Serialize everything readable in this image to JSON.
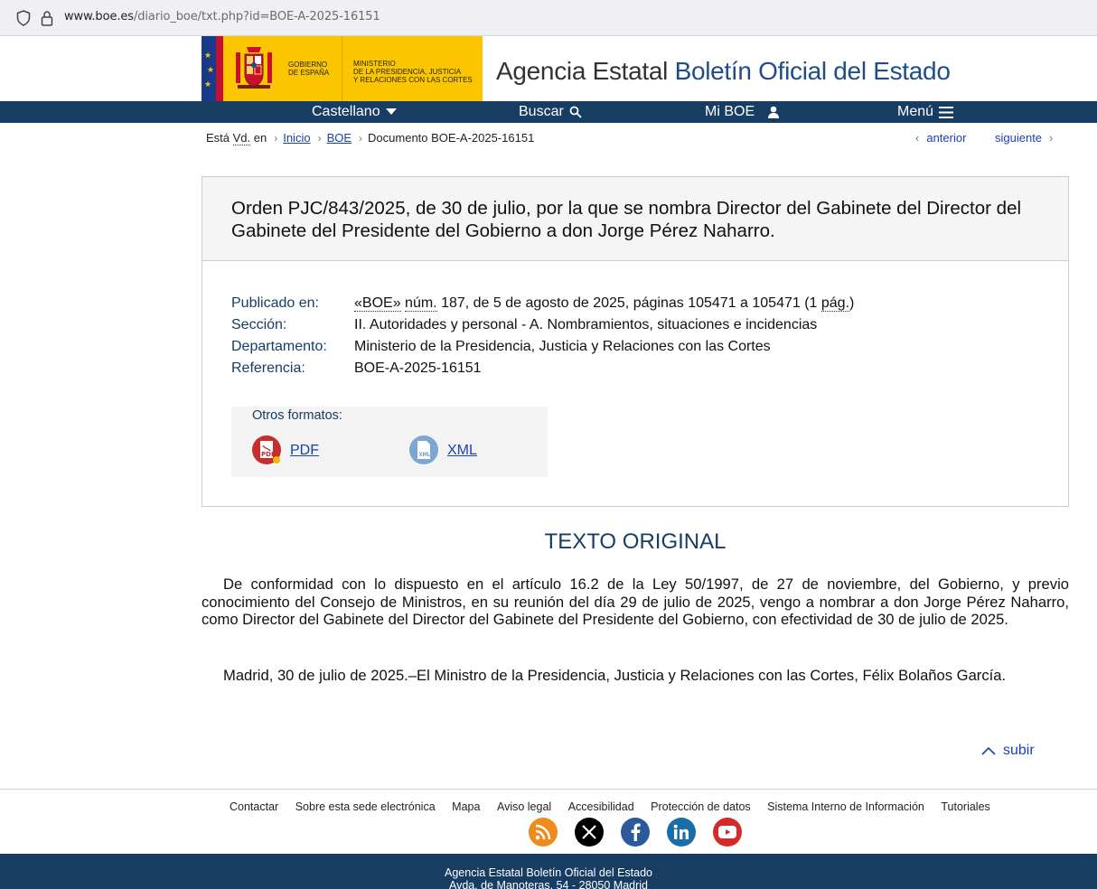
{
  "browser": {
    "url_domain": "www.boe.es",
    "url_path": "/diario_boe/txt.php?id=BOE-A-2025-16151"
  },
  "header": {
    "gobierno": [
      "GOBIERNO",
      "DE ESPAÑA"
    ],
    "ministerio": [
      "MINISTERIO",
      "DE LA PRESIDENCIA, JUSTICIA",
      "Y RELACIONES CON LAS CORTES"
    ],
    "agency_prefix": "Agencia Estatal",
    "agency_name": "Boletín Oficial del Estado"
  },
  "nav": {
    "language": "Castellano",
    "search": "Buscar",
    "my_boe": "Mi BOE",
    "menu": "Menú"
  },
  "breadcrumb": {
    "label_pre": "Está ",
    "label_vd": "Vd.",
    "label_post": " en",
    "items": [
      "Inicio",
      "BOE",
      "Documento BOE-A-2025-16151"
    ],
    "prev": "anterior",
    "next": "siguiente"
  },
  "document": {
    "title": "Orden PJC/843/2025, de 30 de julio, por la que se nombra Director del Gabinete del Director del Gabinete del Presidente del Gobierno a don Jorge Pérez Naharro.",
    "meta": {
      "published_label": "Publicado en:",
      "published_boe": "«BOE»",
      "published_num": "núm.",
      "published_rest": " 187, de 5 de agosto de 2025, páginas 105471 a 105471 (1 ",
      "published_pag": "pág.",
      "published_close": ")",
      "section_label": "Sección:",
      "section_value": "II. Autoridades y personal - A. Nombramientos, situaciones e incidencias",
      "department_label": "Departamento:",
      "department_value": "Ministerio de la Presidencia, Justicia y Relaciones con las Cortes",
      "reference_label": "Referencia:",
      "reference_value": "BOE-A-2025-16151"
    },
    "formats": {
      "label": "Otros formatos:",
      "pdf": "PDF",
      "xml": "XML"
    }
  },
  "body": {
    "section_title": "TEXTO ORIGINAL",
    "paragraph1": "De conformidad con lo dispuesto en el artículo 16.2 de la Ley 50/1997, de 27 de noviembre, del Gobierno, y previo conocimiento del Consejo de Ministros, en su reunión del día 29 de julio de 2025, vengo a nombrar a don Jorge Pérez Naharro, como Director del Gabinete del Director del Gabinete del Presidente del Gobierno, con efectividad de 30 de julio de 2025.",
    "paragraph2": "Madrid, 30 de julio de 2025.–El Ministro de la Presidencia, Justicia y Relaciones con las Cortes, Félix Bolaños García.",
    "back_to_top": "subir"
  },
  "footer": {
    "links": [
      "Contactar",
      "Sobre esta sede electrónica",
      "Mapa",
      "Aviso legal",
      "Accesibilidad",
      "Protección de datos",
      "Sistema Interno de Información",
      "Tutoriales"
    ],
    "socials": [
      {
        "icon": "rss-icon",
        "color": "#f08a1c"
      },
      {
        "icon": "x-icon",
        "color": "#000000"
      },
      {
        "icon": "facebook-icon",
        "color": "#2a5a9a"
      },
      {
        "icon": "linkedin-icon",
        "color": "#1a6ea8"
      },
      {
        "icon": "youtube-icon",
        "color": "#d62a2a"
      }
    ],
    "org": "Agencia Estatal Boletín Oficial del Estado",
    "address": "Avda. de Manoteras, 54 - 28050 Madrid"
  }
}
